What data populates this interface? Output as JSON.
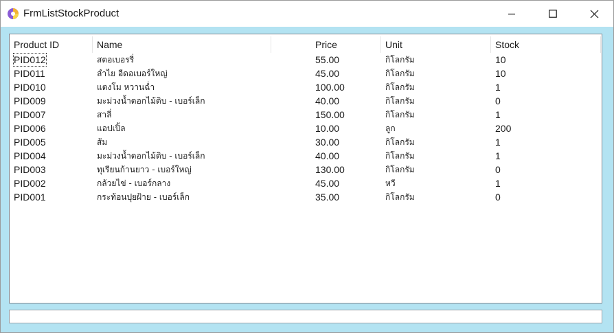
{
  "window": {
    "title": "FrmListStockProduct"
  },
  "table": {
    "columns": [
      "Product ID",
      "Name",
      "",
      "Price",
      "Unit",
      "Stock"
    ],
    "rows": [
      {
        "id": "PID012",
        "name": "สตอเบอรรี่",
        "price": "55.00",
        "unit": "กิโลกรัม",
        "stock": "10"
      },
      {
        "id": "PID011",
        "name": "ลำไย อีดอเบอร์ใหญ่",
        "price": "45.00",
        "unit": "กิโลกรัม",
        "stock": "10"
      },
      {
        "id": "PID010",
        "name": "แตงโม หวานฉ่ำ",
        "price": "100.00",
        "unit": "กิโลกรัม",
        "stock": "1"
      },
      {
        "id": "PID009",
        "name": "มะม่วงน้ำดอกไม้ดิบ - เบอร์เล็ก",
        "price": "40.00",
        "unit": "กิโลกรัม",
        "stock": "0"
      },
      {
        "id": "PID007",
        "name": "สาลี่",
        "price": "150.00",
        "unit": "กิโลกรัม",
        "stock": "1"
      },
      {
        "id": "PID006",
        "name": "แอปเปิ้ล",
        "price": "10.00",
        "unit": "ลูก",
        "stock": "200"
      },
      {
        "id": "PID005",
        "name": "ส้ม",
        "price": "30.00",
        "unit": "กิโลกรัม",
        "stock": "1"
      },
      {
        "id": "PID004",
        "name": "มะม่วงน้ำดอกไม้ดิบ - เบอร์เล็ก",
        "price": "40.00",
        "unit": "กิโลกรัม",
        "stock": "1"
      },
      {
        "id": "PID003",
        "name": "ทุเรียนก้านยาว - เบอร์ใหญ่",
        "price": "130.00",
        "unit": "กิโลกรัม",
        "stock": "0"
      },
      {
        "id": "PID002",
        "name": "กล้วยไข่ - เบอร์กลาง",
        "price": "45.00",
        "unit": "หวี",
        "stock": "1"
      },
      {
        "id": "PID001",
        "name": "กระท้อนปุยฝ้าย - เบอร์เล็ก",
        "price": "35.00",
        "unit": "กิโลกรัม",
        "stock": "0"
      }
    ]
  },
  "status": {
    "text": ""
  },
  "icons": {
    "app": "app-icon",
    "minimize": "minimize-icon",
    "maximize": "maximize-icon",
    "close": "close-icon"
  }
}
